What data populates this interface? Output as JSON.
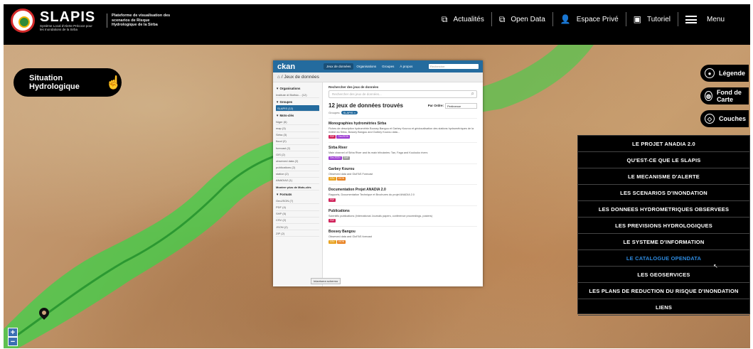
{
  "header": {
    "brand": "SLAPIS",
    "brand_subtitle": "Système Local d'Alerte Précoce pour les Inondations de la Sirba",
    "tagline": "Plateforme de visualisation des scenarios de Risque Hydrologique de la Sirba",
    "nav": [
      {
        "label": "Actualités",
        "icon": "external-link-icon"
      },
      {
        "label": "Open Data",
        "icon": "external-link-icon"
      },
      {
        "label": "Espace Privé",
        "icon": "user-icon"
      },
      {
        "label": "Tutoriel",
        "icon": "document-icon"
      },
      {
        "label": "Menu",
        "icon": "hamburger-icon"
      }
    ]
  },
  "map": {
    "situation_button": "Situation Hydrologique",
    "side_buttons": [
      {
        "label": "Légende",
        "icon": "map-pin-icon"
      },
      {
        "label": "Fond de Carte",
        "icon": "globe-icon"
      },
      {
        "label": "Couches",
        "icon": "layers-icon"
      }
    ],
    "zoom_in": "+",
    "zoom_out": "−"
  },
  "ckan": {
    "logo": "ckan",
    "nav": [
      "Jeux de données",
      "Organisations",
      "Groupes",
      "À propos"
    ],
    "search_placeholder": "Rechercher",
    "breadcrumb": "/ Jeux de données",
    "sidebar": {
      "organisations_title": "Organisations",
      "organisations": [
        "Institute di Biofisic... (12)"
      ],
      "groupes_title": "Groupes",
      "groupes": [
        "SLAPIS (12)"
      ],
      "tags_title": "Mots-clés",
      "tags": [
        "Niger (6)",
        "map (3)",
        "Sirba (3)",
        "flood (2)",
        "forecast (2)",
        "GIS (2)",
        "observed data (2)",
        "publications (2)",
        "station (2)",
        "ANADIA2 (1)"
      ],
      "tags_more": "Montrer plus de Mots-clés",
      "formats_title": "Formats",
      "formats": [
        "GeoJSON (7)",
        "PDF (4)",
        "SHP (5)",
        "CSV (2)",
        "JSON (2)",
        "ZIP (2)"
      ]
    },
    "main": {
      "search_label": "Rechercher des jeux de données",
      "search_placeholder": "Rechercher des jeux de données...",
      "found": "12 jeux de données trouvés",
      "order_label": "Par Ordre:",
      "order_value": "Pertinence",
      "groups_label": "Groupes:",
      "groups_pill": "SLAPIS ×",
      "datasets": [
        {
          "title": "Monographies hydrométries Sirba",
          "desc": "Fiches de description hydrométrie Boosey Bangou et Garbey Kourou et géolocalisation des stations hydrométriques de la rivière du Sirba, Bossey Bangou and Garbey Kourou data...",
          "badges": [
            {
              "t": "PDF",
              "c": "#d1245b"
            },
            {
              "t": "GeoJSON",
              "c": "#9c3ad1"
            }
          ]
        },
        {
          "title": "Sirba River",
          "desc": "Main channel of Sirba River and its main tributaries: Tan, Faga and Koulouko rivers",
          "badges": [
            {
              "t": "GeoJSON",
              "c": "#9c3ad1"
            },
            {
              "t": "SHP",
              "c": "#999999"
            }
          ]
        },
        {
          "title": "Garbey Kourou",
          "desc": "Observed data and GloFAS Forecast",
          "badges": [
            {
              "t": "CSV",
              "c": "#e8a21f"
            },
            {
              "t": "JSON",
              "c": "#e8801f"
            }
          ]
        },
        {
          "title": "Documentation Projet ANADIA 2.0",
          "desc": "Rapports, Documentation Technique et Brochures du projet ANADIA 2.0",
          "badges": [
            {
              "t": "PDF",
              "c": "#d1245b"
            }
          ]
        },
        {
          "title": "Publications",
          "desc": "Scientific publications (International Journals papers, conference proceedings, posters)",
          "badges": [
            {
              "t": "PDF",
              "c": "#d1245b"
            }
          ]
        },
        {
          "title": "Bossey Bangou",
          "desc": "Observed data and GloFAS forecast",
          "badges": [
            {
              "t": "CSV",
              "c": "#e8a21f"
            },
            {
              "t": "JSON",
              "c": "#e8801f"
            }
          ]
        }
      ],
      "tooltip": "Inlarrisera schermo"
    }
  },
  "mega_menu": [
    {
      "label": "LE PROJET ANADIA 2.0",
      "highlight": false
    },
    {
      "label": "QU'EST-CE QUE LE SLAPIS",
      "highlight": false
    },
    {
      "label": "LE MECANISME D'ALERTE",
      "highlight": false
    },
    {
      "label": "LES SCENARIOS D'INONDATION",
      "highlight": false
    },
    {
      "label": "LES DONNEES HYDROMETRIQUES OBSERVEES",
      "highlight": false
    },
    {
      "label": "LES PREVISIONS HYDROLOGIQUES",
      "highlight": false
    },
    {
      "label": "LE SYSTEME D'INFORMATION",
      "highlight": false
    },
    {
      "label": "LE CATALOGUE OPENDATA",
      "highlight": true
    },
    {
      "label": "LES GEOSERVICES",
      "highlight": false
    },
    {
      "label": "LES PLANS DE REDUCTION DU RISQUE D'INONDATION",
      "highlight": false
    },
    {
      "label": "LIENS",
      "highlight": false
    }
  ],
  "colors": {
    "ckan_blue": "#246b9e",
    "river_green": "#3fd14a",
    "menu_highlight": "#2e8be0"
  }
}
